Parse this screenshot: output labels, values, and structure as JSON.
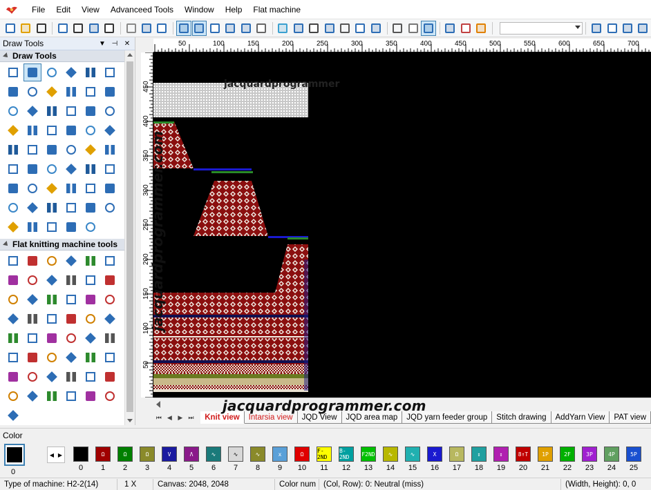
{
  "menu": [
    "File",
    "Edit",
    "View",
    "Advanceed Tools",
    "Window",
    "Help",
    "Flat machine"
  ],
  "toolbar": {
    "icons": [
      "new-file-icon",
      "open-folder-icon",
      "save-icon",
      "undo-icon",
      "undo-dropdown-icon",
      "redo-icon",
      "redo-dropdown-icon",
      "cut-icon",
      "copy-icon",
      "paste-icon",
      "grid-icon",
      "info-icon",
      "zoom-fit-icon",
      "select-area-icon",
      "stitch-icon",
      "record-icon",
      "color-wheel-icon",
      "pencil-icon",
      "yarn-icon",
      "fill-icon",
      "layers-icon",
      "screen-icon",
      "monitor-icon",
      "stack-icon",
      "copy-layer-icon",
      "active-layer-icon",
      "ruler-icon",
      "brush-icon",
      "globe-icon",
      "align-icon",
      "align-h-icon",
      "settings-icon",
      "settings-2-icon"
    ],
    "combo_value": ""
  },
  "panel": {
    "title": "Draw Tools",
    "sections": [
      {
        "title": "Draw Tools"
      },
      {
        "title": "Flat knitting machine tools"
      }
    ]
  },
  "draw_tools": [
    "hand-tool",
    "select-rect-tool",
    "pencil-tool",
    "step-line-tool",
    "line-tool",
    "curve-tool",
    "rect-tool",
    "filled-rect-tool",
    "rounded-rect-tool",
    "filled-rounded-rect-tool",
    "ellipse-tool",
    "filled-ellipse-tool",
    "diamond-tool",
    "filled-diamond-tool",
    "parallelogram-tool",
    "filled-parallelogram-tool",
    "hexagon-tool",
    "filled-hexagon-tool",
    "brush-tool",
    "text-tool",
    "columns-tool",
    "grid-fill-tool",
    "link-tool",
    "bars-tool",
    "rows-tool",
    "blocks-tool",
    "eraser-tool",
    "eraser-2-tool",
    "eraser-3-tool",
    "eraser-4-tool",
    "needle-tool",
    "copy-block-tool",
    "align-left-tool",
    "align-center-tool",
    "bar-chart-tool",
    "bar-chart-2-tool",
    "scissors-tool",
    "cross-tool",
    "frame-tool",
    "frame-2-tool",
    "split-frame-tool",
    "split-frame-2-tool",
    "paint-square-tool",
    "eraser-5-tool",
    "refresh-tool",
    "zoom-tool",
    "cloud-tool",
    "expand-tool",
    "magic-wand-tool",
    "rubber-tool",
    "lasso-tool",
    "grid-select-tool",
    "target-tool"
  ],
  "knit_tools": [
    "knit-tool-1",
    "knit-tool-2",
    "knit-tool-3",
    "knit-tool-4",
    "knit-tool-5",
    "shirt-tool",
    "columns-knit-tool",
    "red-blocks-tool",
    "triangle-tool",
    "triangle-2-tool",
    "needle-knit-tool",
    "redo-knit-tool",
    "down-arrow-tool",
    "dropper-tool",
    "diamond-knit-tool",
    "x-knit-tool",
    "transfer-tool",
    "hod-tool",
    "stripes-tool",
    "color-stripes-tool",
    "red-box-tool",
    "pen-knit-tool",
    "m-tool",
    "loop-tool",
    "pattern-tool",
    "frame-knit-tool",
    "stack-tool",
    "bar-knit-tool",
    "cnt-tool",
    "icj-tool",
    "table-tool",
    "hod-2-tool",
    "icj-2-tool",
    "knot-tool",
    "arrow-down-tool",
    "blocks-2-tool",
    "edit-tool",
    "layers-knit-tool",
    "grid-red-tool",
    "dots-tool",
    "steps-tool",
    "slope-tool",
    "triangle-3-tool",
    "dual-arrow-tool",
    "dual-arrow-2-tool",
    "dual-arrow-3-tool",
    "gear-knit-tool",
    "dual-arrow-4-tool",
    "gear-2-tool"
  ],
  "ruler_h": [
    "50",
    "100",
    "150",
    "200",
    "250",
    "300",
    "350",
    "400",
    "450",
    "500",
    "550",
    "600",
    "650",
    "700"
  ],
  "ruler_v": [
    "450",
    "400",
    "350",
    "300",
    "250",
    "200",
    "150",
    "100",
    "50"
  ],
  "tabs": {
    "items": [
      {
        "label": "Knit view",
        "state": "active"
      },
      {
        "label": "Intarsia view",
        "state": "red"
      },
      {
        "label": "JQD View",
        "state": ""
      },
      {
        "label": "JQD area map",
        "state": ""
      },
      {
        "label": "JQD yarn feeder group",
        "state": ""
      },
      {
        "label": "Stitch drawing",
        "state": ""
      },
      {
        "label": "AddYarn View",
        "state": ""
      },
      {
        "label": "PAT view",
        "state": ""
      }
    ]
  },
  "watermark": {
    "bottom": "jacquardprogrammer.com",
    "vertical": "jacquardprogrammer.com",
    "top_smudge": "jacquardprogrammer"
  },
  "color_panel": {
    "title": "Color",
    "current_label": "0",
    "swatches": [
      {
        "num": "0",
        "color": "#000000",
        "glyph": ""
      },
      {
        "num": "1",
        "color": "#a00000",
        "glyph": "Ω"
      },
      {
        "num": "2",
        "color": "#008000",
        "glyph": "Ω"
      },
      {
        "num": "3",
        "color": "#8a8a2a",
        "glyph": "Ω"
      },
      {
        "num": "4",
        "color": "#1a1aa0",
        "glyph": "V"
      },
      {
        "num": "5",
        "color": "#8a1a8a",
        "glyph": "Λ"
      },
      {
        "num": "6",
        "color": "#1a7a7a",
        "glyph": "∿"
      },
      {
        "num": "7",
        "color": "#d8d8d8",
        "glyph": "∿"
      },
      {
        "num": "8",
        "color": "#8a8a2a",
        "glyph": "∿"
      },
      {
        "num": "9",
        "color": "#5aa0d8",
        "glyph": "x"
      },
      {
        "num": "10",
        "color": "#e00000",
        "glyph": "Ω"
      },
      {
        "num": "11",
        "color": "#ffff00",
        "glyph": "F-2ND"
      },
      {
        "num": "12",
        "color": "#00a0a0",
        "glyph": "B-2ND"
      },
      {
        "num": "13",
        "color": "#00c000",
        "glyph": "F2ND"
      },
      {
        "num": "14",
        "color": "#b8b800",
        "glyph": "∿"
      },
      {
        "num": "15",
        "color": "#20b0b0",
        "glyph": "∿"
      },
      {
        "num": "16",
        "color": "#1a1ad0",
        "glyph": "X"
      },
      {
        "num": "17",
        "color": "#b8b860",
        "glyph": "Ω"
      },
      {
        "num": "18",
        "color": "#20a0a0",
        "glyph": "↕"
      },
      {
        "num": "19",
        "color": "#b020b0",
        "glyph": "↕"
      },
      {
        "num": "20",
        "color": "#c00000",
        "glyph": "8↑T"
      },
      {
        "num": "21",
        "color": "#e0a000",
        "glyph": "1P"
      },
      {
        "num": "22",
        "color": "#00b000",
        "glyph": "2F"
      },
      {
        "num": "23",
        "color": "#a020d0",
        "glyph": "3P"
      },
      {
        "num": "24",
        "color": "#60a060",
        "glyph": "4P"
      },
      {
        "num": "25",
        "color": "#1a50d0",
        "glyph": "5P"
      }
    ]
  },
  "status": {
    "machine": "Type of machine: H2-2(14)",
    "zoom": "1 X",
    "canvas": "Canvas: 2048, 2048",
    "color_num": "Color num",
    "colrow": "(Col, Row): 0: Neutral (miss)",
    "wh": "(Width, Height): 0, 0"
  }
}
